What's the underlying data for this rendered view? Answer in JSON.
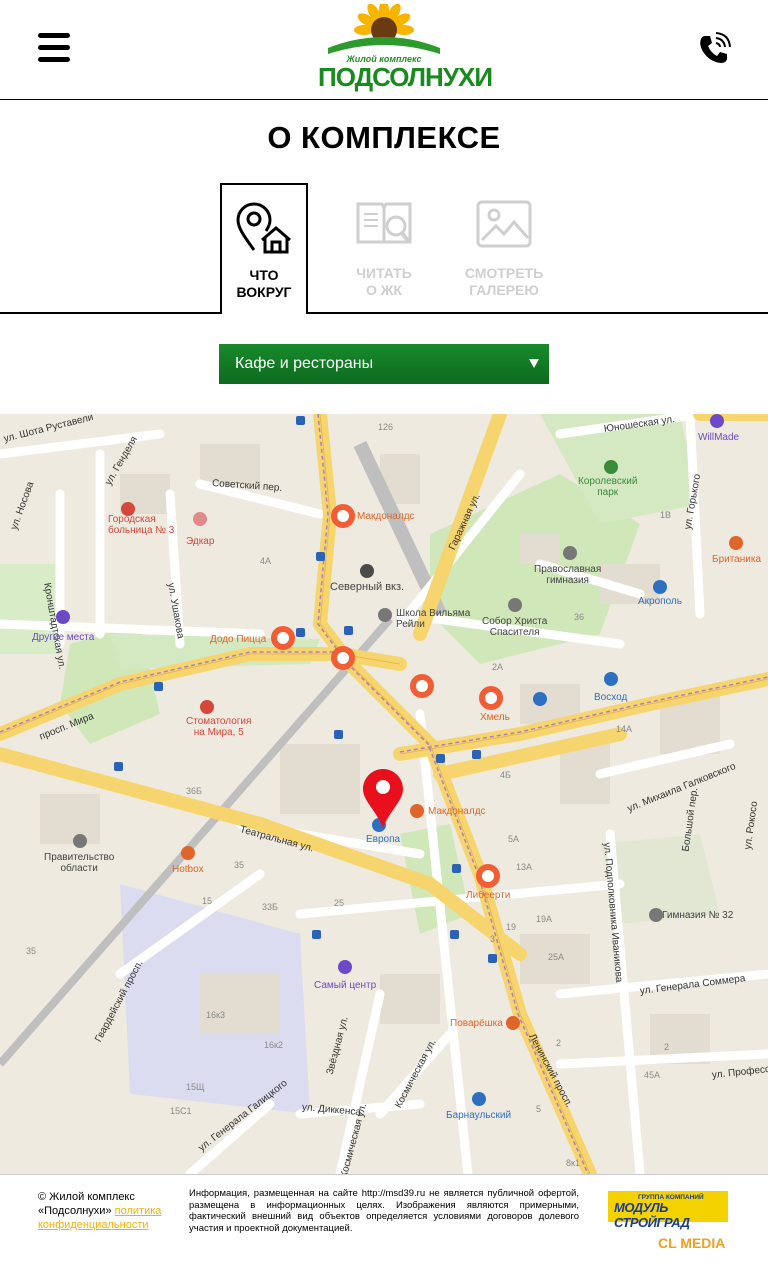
{
  "header": {
    "logo_sub": "Жилой комплекс",
    "logo_main": "ПОДСОЛНУХИ"
  },
  "page": {
    "title": "О КОМПЛЕКСЕ"
  },
  "tabs": [
    {
      "label": "ЧТО\nВОКРУГ",
      "active": true
    },
    {
      "label": "ЧИТАТЬ\nО ЖК",
      "active": false
    },
    {
      "label": "СМОТРЕТЬ\nГАЛЕРЕЮ",
      "active": false
    }
  ],
  "select": {
    "value": "Кафе и рестораны"
  },
  "map": {
    "streets": {
      "rustaveli": "ул. Шота Руставели",
      "gendelya": "ул. Генделя",
      "nosova": "ул. Носова",
      "kronshtadt": "Кронштадтская ул.",
      "ushakova": "ул. Ушакова",
      "sovetsky": "Советский пер.",
      "garazhnaya": "Гаражная ул.",
      "yunosheskaya": "Юношеская ул.",
      "gorkogo": "ул. Горького",
      "mira": "просп. Мира",
      "teatralnaya": "Театральная ул.",
      "gvardeysky": "Гвардейский просп.",
      "galkovskogo": "ул. Михаила Галковского",
      "bolshoy": "Большой пер.",
      "podpolkovnika": "ул. Подполковника Иваникова",
      "sommera": "ул. Генерала Соммера",
      "leninsky": "Ленинский просп.",
      "zvezdnaya": "Звёздная ул.",
      "kosmicheskaya": "Космическая ул.",
      "dikkensa": "ул. Диккенса",
      "galitskogo": "ул. Генерала Галицкого",
      "professora": "ул. Профессо",
      "rokossovskogo": "ул. Рокосо",
      "kosmich2": "Космическая ул."
    },
    "pois": {
      "bolnica": "Городская\nбольница № 3",
      "edkar": "Эдкар",
      "mcd1": "Макдоналдс",
      "sevvokzal": "Северный вкз.",
      "shkola": "Школа Вильяма\nРейли",
      "pravgimn": "Православная\nгимназия",
      "sobor": "Собор Христа\nСпасителя",
      "akropol": "Акрополь",
      "korolev": "Королевский\nпарк",
      "britanika": "Британика",
      "willmade": "WillMade",
      "drugie": "Другие места",
      "dodo": "Додо Пицца",
      "stomat": "Стоматология\nна Мира, 5",
      "khmel": "Хмель",
      "voskhod": "Восход",
      "mcd2": "Макдоналдс",
      "evropa": "Европа",
      "pravitelstvo": "Правительство\nобласти",
      "hotbox": "Hotbox",
      "libeerti": "Либеерти",
      "gimn32": "Гимназия № 32",
      "samiy": "Самый центр",
      "povareshka": "Поварёшка",
      "barnaulsky": "Барнаульский"
    },
    "numbers": [
      "126",
      "1B",
      "4A",
      "36",
      "2A",
      "14A",
      "4Б",
      "5A",
      "13A",
      "35",
      "33Б",
      "25",
      "15",
      "16к3",
      "16к2",
      "15Щ",
      "15С1",
      "3",
      "19",
      "19A",
      "25A",
      "36Б",
      "35",
      "2",
      "45A",
      "2",
      "5",
      "8к1"
    ]
  },
  "footer": {
    "copy_text": "© Жилой комплекс «Подсолнухи»",
    "policy_link": "политика конфиденциальности",
    "info": "Информация, размещенная на сайте http://msd39.ru не является публичной офертой, размещена в информационных целях. Изображения являются примерными, фактический внешний вид объектов определяется условиями договоров долевого участия и проектной документацией.",
    "modul_small": "ГРУППА КОМПАНИЙ",
    "modul_big": "МОДУЛЬ СТРОЙГРАД",
    "clmedia": "CL MEDIA"
  },
  "colors": {
    "accent_green": "#188a2c",
    "marker_orange": "#f15e35",
    "pin_red": "#e8101c"
  }
}
